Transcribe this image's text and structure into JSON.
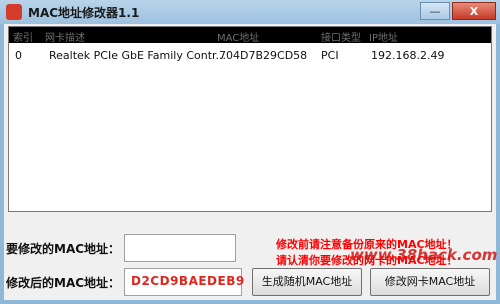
{
  "window": {
    "title": "MAC地址修改器1.1",
    "minimize_label": "—",
    "close_label": "X"
  },
  "table": {
    "columns": [
      "索引",
      "网卡描述",
      "MAC地址",
      "接口类型",
      "IP地址"
    ],
    "rows": [
      [
        "0",
        "Realtek PCIe GbE Family Contr...",
        "704D7B29CD58",
        "PCI",
        "192.168.2.49"
      ]
    ]
  },
  "form": {
    "current_mac_label": "要修改的MAC地址：",
    "current_mac_value": "",
    "new_mac_label": "修改后的MAC地址：",
    "new_mac_value": "D2CD9BAEDEB9",
    "warning_line1": "修改前请注意备份原来的MAC地址！",
    "warning_line2": "请认清你要修改的网卡的MAC地址！",
    "generate_button": "生成随机MAC地址",
    "modify_button": "修改网卡MAC地址",
    "watermark": "www.38hack.com"
  },
  "colors": {
    "accent_red": "#ff0000",
    "mac_value_red": "#e0261e",
    "header_bg": "#000000"
  }
}
